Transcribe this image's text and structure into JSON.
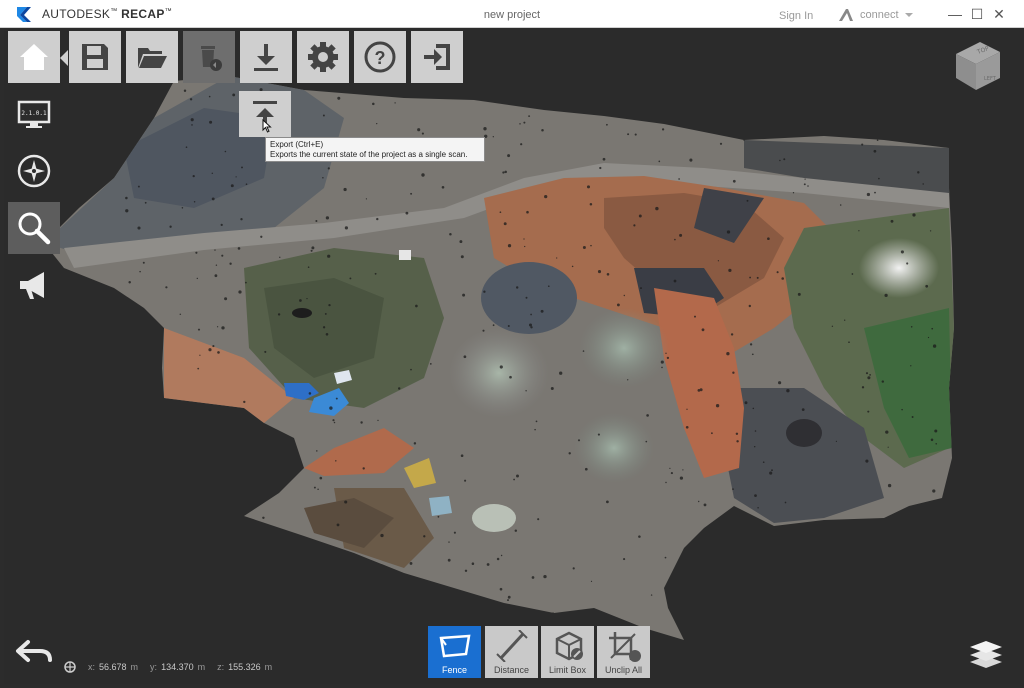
{
  "titlebar": {
    "brand_light": "AUTODESK",
    "brand_bold": "RECAP",
    "brand_tm": "™",
    "doc_title": "new project",
    "sign_in": "Sign In",
    "connect": "connect",
    "minimize": "—",
    "maximize": "☐",
    "close": "✕"
  },
  "toolbar": {
    "items": [
      {
        "name": "home",
        "icon": "home-icon"
      },
      {
        "name": "save",
        "icon": "floppy-disk-icon"
      },
      {
        "name": "open",
        "icon": "folder-icon"
      },
      {
        "name": "delete",
        "icon": "trash-icon"
      },
      {
        "name": "import-export",
        "icon": "download-icon"
      },
      {
        "name": "settings",
        "icon": "gear-icon"
      },
      {
        "name": "help",
        "icon": "question-icon"
      },
      {
        "name": "exit",
        "icon": "exit-icon"
      }
    ],
    "export_icon": "export-icon"
  },
  "tooltip": {
    "title": "Export (Ctrl+E)",
    "description": "Exports the current state of the project as a single scan."
  },
  "sidebar": {
    "items": [
      {
        "name": "display",
        "icon": "monitor-icon",
        "screen_text": "2.1.0.1"
      },
      {
        "name": "navigation",
        "icon": "compass-icon"
      },
      {
        "name": "search",
        "icon": "search-icon",
        "active": true
      },
      {
        "name": "annotate",
        "icon": "megaphone-icon"
      }
    ]
  },
  "viewcube": {
    "top": "TOP",
    "left": "LEFT"
  },
  "coordinates": {
    "x_label": "x:",
    "x_value": "56.678",
    "x_unit": "m",
    "y_label": "y:",
    "y_value": "134.370",
    "y_unit": "m",
    "z_label": "z:",
    "z_value": "155.326",
    "z_unit": "m"
  },
  "measure_tools": [
    {
      "label": "Fence",
      "icon": "fence-icon",
      "active": true
    },
    {
      "label": "Distance",
      "icon": "distance-icon"
    },
    {
      "label": "Limit Box",
      "icon": "limit-box-icon"
    },
    {
      "label": "Unclip All",
      "icon": "unclip-icon"
    }
  ],
  "colors": {
    "accent": "#1a6fd1",
    "viewport_bg": "#2b2b2b",
    "button_bg": "#cfcfcf",
    "icon": "#444444"
  }
}
